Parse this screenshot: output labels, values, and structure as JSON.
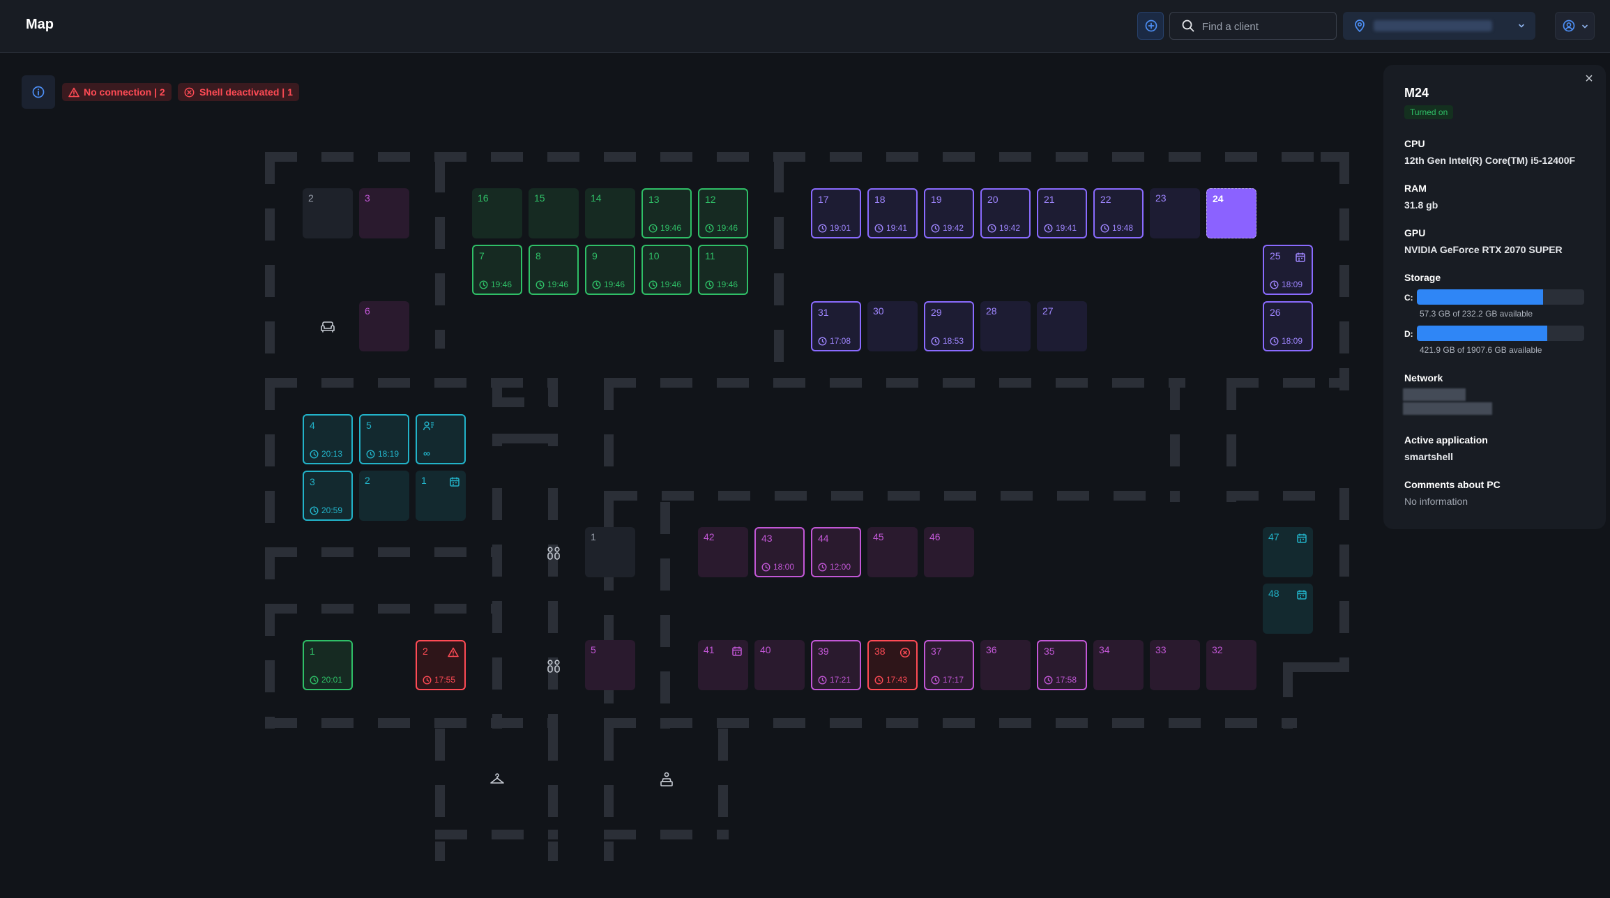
{
  "header": {
    "title": "Map",
    "search_placeholder": "Find a client"
  },
  "alerts": [
    {
      "label": "No connection | 2",
      "icon": "warning-triangle-icon"
    },
    {
      "label": "Shell deactivated | 1",
      "icon": "x-circle-icon"
    }
  ],
  "colors": {
    "green": "#2fbf67",
    "purple": "#8a6bff",
    "magenta": "#c257d6",
    "teal": "#22b3c9",
    "red": "#ff4b55",
    "selected": "#8b62ff",
    "accent": "#2f86f6"
  },
  "pcs": [
    {
      "id": "2",
      "tone": "gray"
    },
    {
      "id": "3",
      "tone": "magenta"
    },
    {
      "id": "6",
      "tone": "magenta"
    },
    {
      "id": "16",
      "tone": "green"
    },
    {
      "id": "15",
      "tone": "green"
    },
    {
      "id": "14",
      "tone": "green"
    },
    {
      "id": "13",
      "tone": "green",
      "time": "19:46",
      "active": true
    },
    {
      "id": "12",
      "tone": "green",
      "time": "19:46",
      "active": true
    },
    {
      "id": "7",
      "tone": "green",
      "time": "19:46",
      "active": true
    },
    {
      "id": "8",
      "tone": "green",
      "time": "19:46",
      "active": true
    },
    {
      "id": "9",
      "tone": "green",
      "time": "19:46",
      "active": true
    },
    {
      "id": "10",
      "tone": "green",
      "time": "19:46",
      "active": true
    },
    {
      "id": "11",
      "tone": "green",
      "time": "19:46",
      "active": true
    },
    {
      "id": "17",
      "tone": "purple",
      "time": "19:01",
      "active": true
    },
    {
      "id": "18",
      "tone": "purple",
      "time": "19:41",
      "active": true
    },
    {
      "id": "19",
      "tone": "purple",
      "time": "19:42",
      "active": true
    },
    {
      "id": "20",
      "tone": "purple",
      "time": "19:42",
      "active": true
    },
    {
      "id": "21",
      "tone": "purple",
      "time": "19:41",
      "active": true
    },
    {
      "id": "22",
      "tone": "purple",
      "time": "19:48",
      "active": true
    },
    {
      "id": "23",
      "tone": "purple"
    },
    {
      "id": "24",
      "tone": "purple",
      "selected": true
    },
    {
      "id": "25",
      "tone": "purple",
      "time": "18:09",
      "active": true,
      "icon": "calendar-icon"
    },
    {
      "id": "26",
      "tone": "purple",
      "time": "18:09",
      "active": true
    },
    {
      "id": "31",
      "tone": "purple",
      "time": "17:08",
      "active": true
    },
    {
      "id": "30",
      "tone": "purple"
    },
    {
      "id": "29",
      "tone": "purple",
      "time": "18:53",
      "active": true
    },
    {
      "id": "28",
      "tone": "purple"
    },
    {
      "id": "27",
      "tone": "purple"
    },
    {
      "id": "4",
      "tone": "teal",
      "time": "20:13",
      "active": true
    },
    {
      "id": "5",
      "tone": "teal",
      "time": "18:19",
      "active": true
    },
    {
      "id": "",
      "tone": "teal",
      "active": true,
      "icon_left": "user-group-icon",
      "infinity": "∞"
    },
    {
      "id": "3",
      "tone": "teal",
      "time": "20:59",
      "active": true
    },
    {
      "id": "2",
      "tone": "teal"
    },
    {
      "id": "1",
      "tone": "teal",
      "icon": "calendar-icon"
    },
    {
      "id": "1",
      "tone": "gray"
    },
    {
      "id": "42",
      "tone": "magenta"
    },
    {
      "id": "43",
      "tone": "magenta",
      "time": "18:00",
      "active": true
    },
    {
      "id": "44",
      "tone": "magenta",
      "time": "12:00",
      "active": true
    },
    {
      "id": "45",
      "tone": "magenta"
    },
    {
      "id": "46",
      "tone": "magenta"
    },
    {
      "id": "47",
      "tone": "teal",
      "icon": "calendar-icon"
    },
    {
      "id": "48",
      "tone": "teal",
      "icon": "calendar-icon"
    },
    {
      "id": "1",
      "tone": "green",
      "time": "20:01",
      "active": true
    },
    {
      "id": "2",
      "tone": "red",
      "time": "17:55",
      "active": true,
      "icon": "warning-triangle-icon"
    },
    {
      "id": "5",
      "tone": "magenta"
    },
    {
      "id": "41",
      "tone": "magenta",
      "icon": "calendar-icon"
    },
    {
      "id": "40",
      "tone": "magenta"
    },
    {
      "id": "39",
      "tone": "magenta",
      "time": "17:21",
      "active": true
    },
    {
      "id": "38",
      "tone": "red",
      "time": "17:43",
      "active": true,
      "icon": "x-circle-icon"
    },
    {
      "id": "37",
      "tone": "magenta",
      "time": "17:17",
      "active": true
    },
    {
      "id": "36",
      "tone": "magenta"
    },
    {
      "id": "35",
      "tone": "magenta",
      "time": "17:58",
      "active": true
    },
    {
      "id": "34",
      "tone": "magenta"
    },
    {
      "id": "33",
      "tone": "magenta"
    },
    {
      "id": "32",
      "tone": "magenta"
    }
  ],
  "amenities": [
    "sofa-icon",
    "restroom-icon",
    "restroom-icon",
    "coat-hanger-icon",
    "cashier-icon"
  ],
  "details": {
    "title": "M24",
    "status": "Turned on",
    "cpu_label": "CPU",
    "cpu_value": "12th Gen Intel(R) Core(TM) i5-12400F",
    "ram_label": "RAM",
    "ram_value": "31.8 gb",
    "gpu_label": "GPU",
    "gpu_value": "NVIDIA GeForce RTX 2070 SUPER",
    "storage_label": "Storage",
    "drives": [
      {
        "name": "C:",
        "text": "57.3 GB of 232.2 GB available",
        "used_fraction": 0.753
      },
      {
        "name": "D:",
        "text": "421.9 GB of 1907.6 GB available",
        "used_fraction": 0.779
      }
    ],
    "network_label": "Network",
    "app_label": "Active application",
    "app_value": "smartshell",
    "comments_label": "Comments about PC",
    "comments_value": "No information"
  }
}
